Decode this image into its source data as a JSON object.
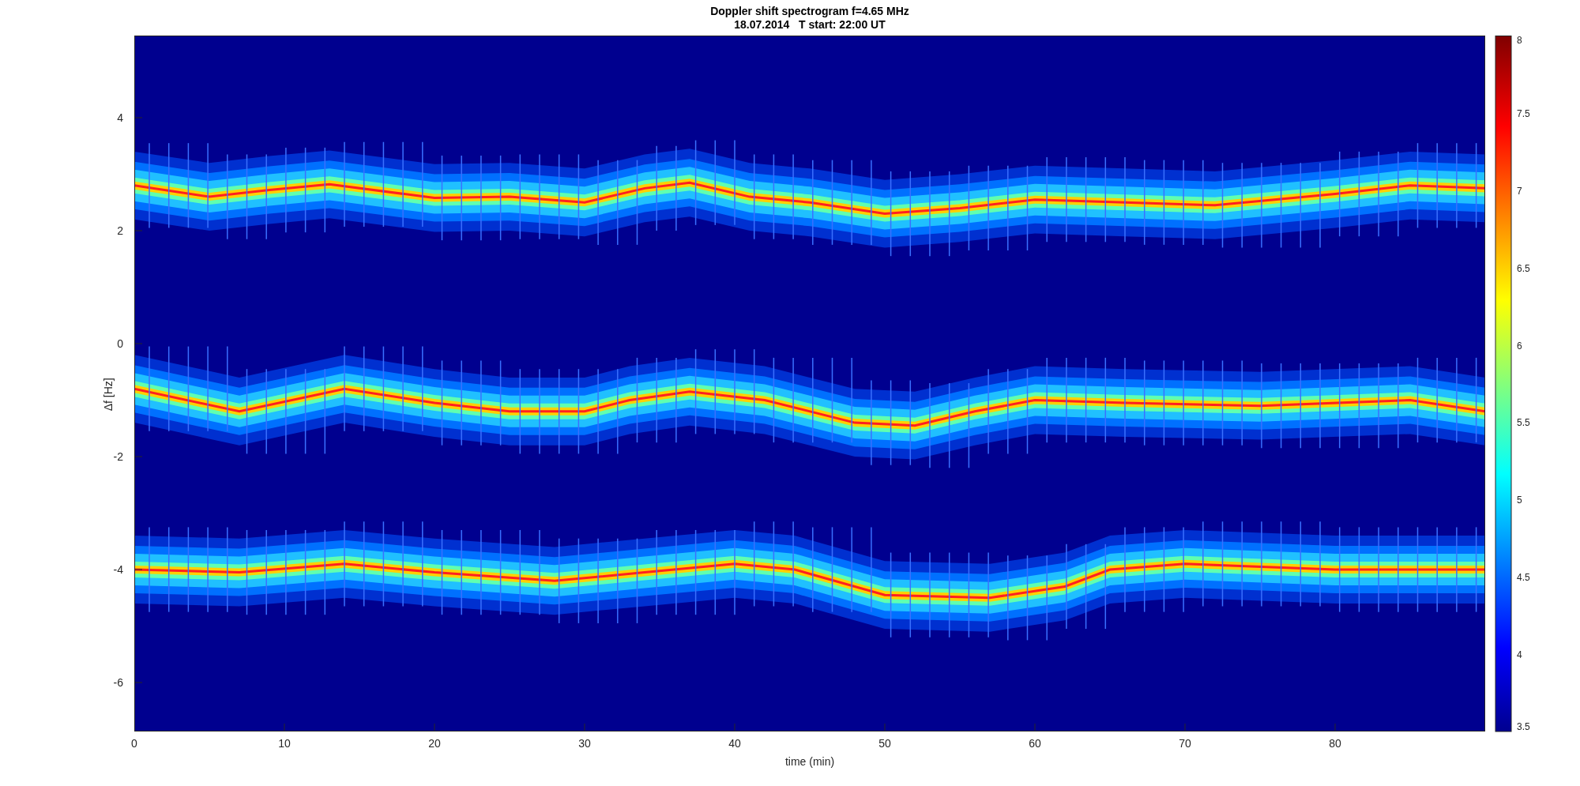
{
  "title": "Doppler shift spectrogram f=4.65 MHz",
  "subtitle": "18.07.2014   T start: 22:00 UT",
  "plot": {
    "xlabel": "time (min)",
    "ylabel": "Δf [Hz]",
    "xticks": [
      "0",
      "10",
      "20",
      "30",
      "40",
      "50",
      "60",
      "70",
      "80"
    ],
    "yticks": [
      "4",
      "2",
      "0",
      "-2",
      "-4",
      "-6"
    ]
  },
  "colorbar": {
    "ticks": [
      "8",
      "7.5",
      "7",
      "6.5",
      "6",
      "5.5",
      "5",
      "4.5",
      "4",
      "3.5"
    ]
  }
}
